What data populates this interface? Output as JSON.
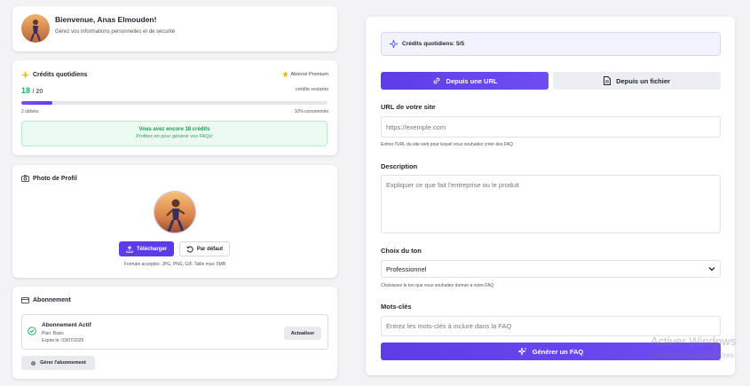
{
  "welcome": {
    "title": "Bienvenue, Anas Elmouden!",
    "subtitle": "Gérez vos informations personnelles et de sécurité"
  },
  "credits": {
    "title": "Crédits quotidiens",
    "badge": "Abonné Premium",
    "count": "18",
    "total": "/ 20",
    "remaining_label": "crédits restants",
    "progress_fraction": 0.1,
    "used": "2 utilisés",
    "percent": "10% consommés",
    "notice_title": "Vous avez encore 18 crédits",
    "notice_sub": "Profitez-en pour générer vos FAQs!"
  },
  "photo": {
    "title": "Photo de Profil",
    "upload_label": "Télécharger",
    "default_label": "Par défaut",
    "formats": "Formats acceptés: JPG, PNG, GIF. Taille max: 5MB"
  },
  "subscription": {
    "title": "Abonnement",
    "status": "Abonnement Actif",
    "plan": "Plan: Basic",
    "expires": "Expire le: 03/07/2025",
    "update_label": "Actualiser",
    "manage_label": "Gérer l'abonnement"
  },
  "form": {
    "banner": "Crédits quotidiens: 5/5",
    "tab_url": "Depuis une URL",
    "tab_file": "Depuis un fichier",
    "url_label": "URL de votre site",
    "url_placeholder": "https://exemple.com",
    "url_hint": "Entrez l'URL du site web pour lequel vous souhaitez créer des FAQ",
    "desc_label": "Description",
    "desc_placeholder": "Expliquer ce que fait l'entreprise ou le produit",
    "tone_label": "Choix du ton",
    "tone_value": "Professionnel",
    "tone_hint": "Choisissez le ton que vous souhaitez donner à votre FAQ",
    "kw_label": "Mots-clés",
    "kw_placeholder": "Entrez les mots-clés à inclure dans la FAQ",
    "generate_label": "Générer un FAQ"
  },
  "watermark": {
    "line1": "Activer Windows",
    "line2": "Accédez aux paramètres"
  },
  "colors": {
    "accent": "#5b3ce6",
    "success": "#22b35a",
    "star": "#f5b400"
  }
}
